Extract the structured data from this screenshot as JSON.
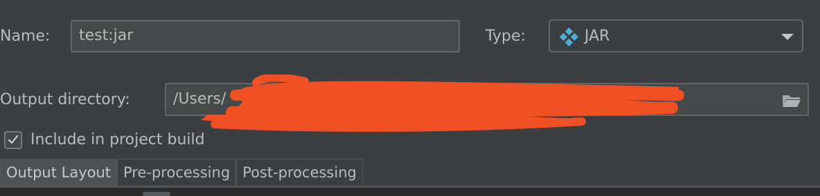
{
  "form": {
    "name_label": "Name:",
    "name_value": "test:jar",
    "type_label": "Type:",
    "type_value": "JAR",
    "type_icon": "jar-artifact-icon",
    "output_dir_label": "Output directory:",
    "output_dir_value": "/Users/",
    "include_label": "Include in project build",
    "include_checked": true
  },
  "tabs": [
    {
      "label": "Output Layout",
      "selected": true
    },
    {
      "label": "Pre-processing",
      "selected": false
    },
    {
      "label": "Post-processing",
      "selected": false
    }
  ],
  "colors": {
    "background": "#3c3f41",
    "text": "#bbbbbb",
    "field_border": "#646464",
    "jar_icon": "#4ab0dd",
    "redaction": "#f05024"
  }
}
